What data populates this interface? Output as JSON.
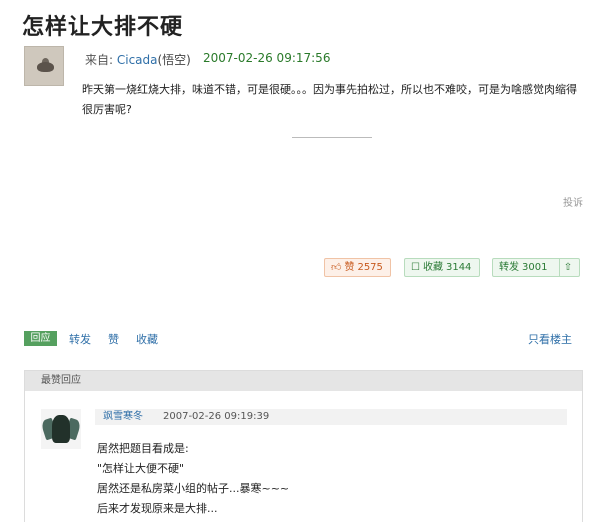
{
  "post": {
    "title": "怎样让大排不硬",
    "from_label": "来自: ",
    "author": "Cicada",
    "author_suffix": "(悟空)",
    "timestamp": "2007-02-26 09:17:56",
    "body": "昨天第一烧红烧大排，味道不错，可是很硬。。。因为事先拍松过，所以也不难咬，可是为啥感觉肉缩得很厉害呢?",
    "report_label": "投诉"
  },
  "reactions": {
    "like_label": "赞",
    "like_count": "2575",
    "fav_label": "收藏",
    "fav_count": "3144",
    "forward_label": "转发",
    "forward_count": "3001"
  },
  "actions": {
    "reply": "回应",
    "forward": "转发",
    "like": "赞",
    "favorite": "收藏",
    "only_owner": "只看楼主"
  },
  "top_replies": {
    "header": "最赞回应",
    "items": [
      {
        "user": "飒雪寒冬",
        "timestamp": "2007-02-26 09:19:39",
        "lines": [
          "居然把题目看成是:",
          "\"怎样让大便不硬\"",
          "居然还是私房菜小组的帖子...暴寒~~~",
          "后来才发现原来是大排..."
        ]
      }
    ]
  },
  "colors": {
    "link": "#2f6fa8",
    "timestamp_green": "#2a7a2a",
    "reply_button": "#55a05f",
    "like_accent": "#c85a1e"
  }
}
